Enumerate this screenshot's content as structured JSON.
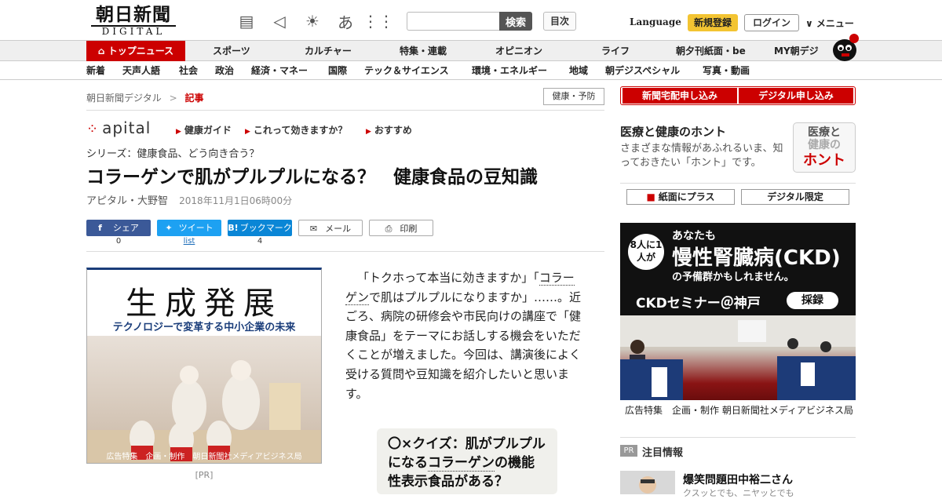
{
  "header": {
    "logo_top": "朝日新聞",
    "logo_bottom": "DIGITAL",
    "search_placeholder": "",
    "search_button": "検索",
    "contents_button": "目次",
    "language": "Language",
    "register": "新規登録",
    "login": "ログイン",
    "menu": "∨ メニュー"
  },
  "nav_main": [
    "トップニュース",
    "スポーツ",
    "カルチャー",
    "特集・連載",
    "オピニオン",
    "ライフ",
    "朝夕刊紙面・be",
    "MY朝デジ"
  ],
  "nav_sub": [
    "新着",
    "天声人語",
    "社会",
    "政治",
    "経済・マネー",
    "国際",
    "テック＆サイエンス",
    "環境・エネルギー",
    "地域",
    "朝デジスペシャル",
    "写真・動画"
  ],
  "breadcrumb": {
    "home": "朝日新聞デジタル",
    "sep": ">",
    "current": "記事"
  },
  "category_tag": "健康・予防",
  "apital": {
    "brand": "apital",
    "links": [
      "健康ガイド",
      "これって効きますか？",
      "おすすめ"
    ]
  },
  "article": {
    "series": "シリーズ：健康食品、どう向き合う？",
    "title": "コラーゲンで肌がプルプルになる？　健康食品の豆知識",
    "author": "アピタル・大野智",
    "date": "2018年11月1日06時00分",
    "body_pre": "「トクホって本当に効きますか」「",
    "body_link": "コラーゲン",
    "body_post": "で肌はプルプルになりますか」……。近ごろ、病院の研修会や市民向けの講座で「健康食品」をテーマにお話しする機会をいただくことが増えました。今回は、講演後によく受ける質問や豆知識を紹介したいと思います。",
    "quiz_pre": "〇×クイズ：肌がプルプルになる",
    "quiz_link": "コラーゲン",
    "quiz_post": "の機能性表示食品がある？"
  },
  "share": {
    "facebook": "シェア",
    "facebook_count": "0",
    "twitter": "ツイート",
    "twitter_count": "list",
    "hatena": "ブックマーク",
    "hatena_count": "4",
    "mail": "メール",
    "print": "印刷"
  },
  "ad_left": {
    "title": "生成発展",
    "subtitle": "テクノロジーで変革する中小企業の未来",
    "caption": "広告特集　企画・制作　朝日新聞社メディアビジネス局",
    "pr": "[PR]"
  },
  "sidebar": {
    "btn_paper": "新聞宅配申し込み",
    "btn_digital": "デジタル申し込み",
    "health_heading": "医療と健康のホント",
    "health_desc": "さまざまな情報があふれるいま、知っておきたい「ホント」です。",
    "health_logo_1": "医療と",
    "health_logo_2": "健康の",
    "health_logo_3": "ホント",
    "plus_btn": "紙面にプラス",
    "digital_only": "デジタル限定",
    "ad_badge": "8人に1人が",
    "ad_line1": "あなたも",
    "ad_line2": "慢性腎臓病(CKD)",
    "ad_line3": "の予備群かもしれません。",
    "ad_seminar": "CKDセミナー＠神戸",
    "ad_record": "採録",
    "ad_caption": "広告特集　企画・制作 朝日新聞社メディアビジネス局",
    "pr_badge": "PR",
    "attention": "注目情報",
    "news_title": "爆笑問題田中裕二さん",
    "news_sub": "クスッとでも、ニヤッとでも"
  }
}
